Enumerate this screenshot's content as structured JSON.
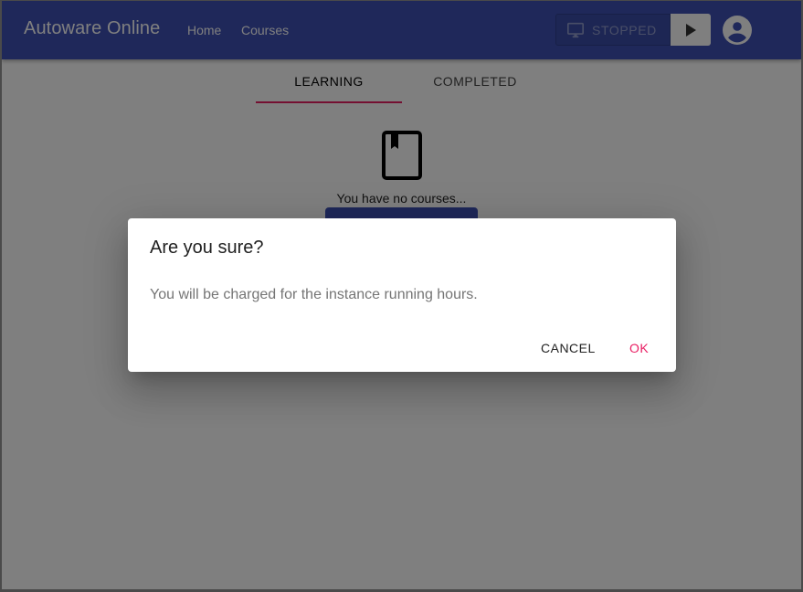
{
  "appbar": {
    "title": "Autoware Online",
    "nav": [
      {
        "label": "Home"
      },
      {
        "label": "Courses"
      }
    ],
    "instance": {
      "status_label": "STOPPED",
      "status_icon": "desktop-icon",
      "action_icon": "play-icon"
    },
    "account_icon": "account-circle-icon"
  },
  "tabs": [
    {
      "label": "LEARNING",
      "active": true
    },
    {
      "label": "COMPLETED",
      "active": false
    }
  ],
  "empty_state": {
    "icon": "book-icon",
    "text": "You have no courses..."
  },
  "dialog": {
    "title": "Are you sure?",
    "message": "You will be charged for the instance running hours.",
    "cancel_label": "CANCEL",
    "ok_label": "OK"
  },
  "colors": {
    "primary": "#3f51b5",
    "accent": "#e91e63",
    "backdrop": "rgba(0,0,0,0.5)"
  }
}
